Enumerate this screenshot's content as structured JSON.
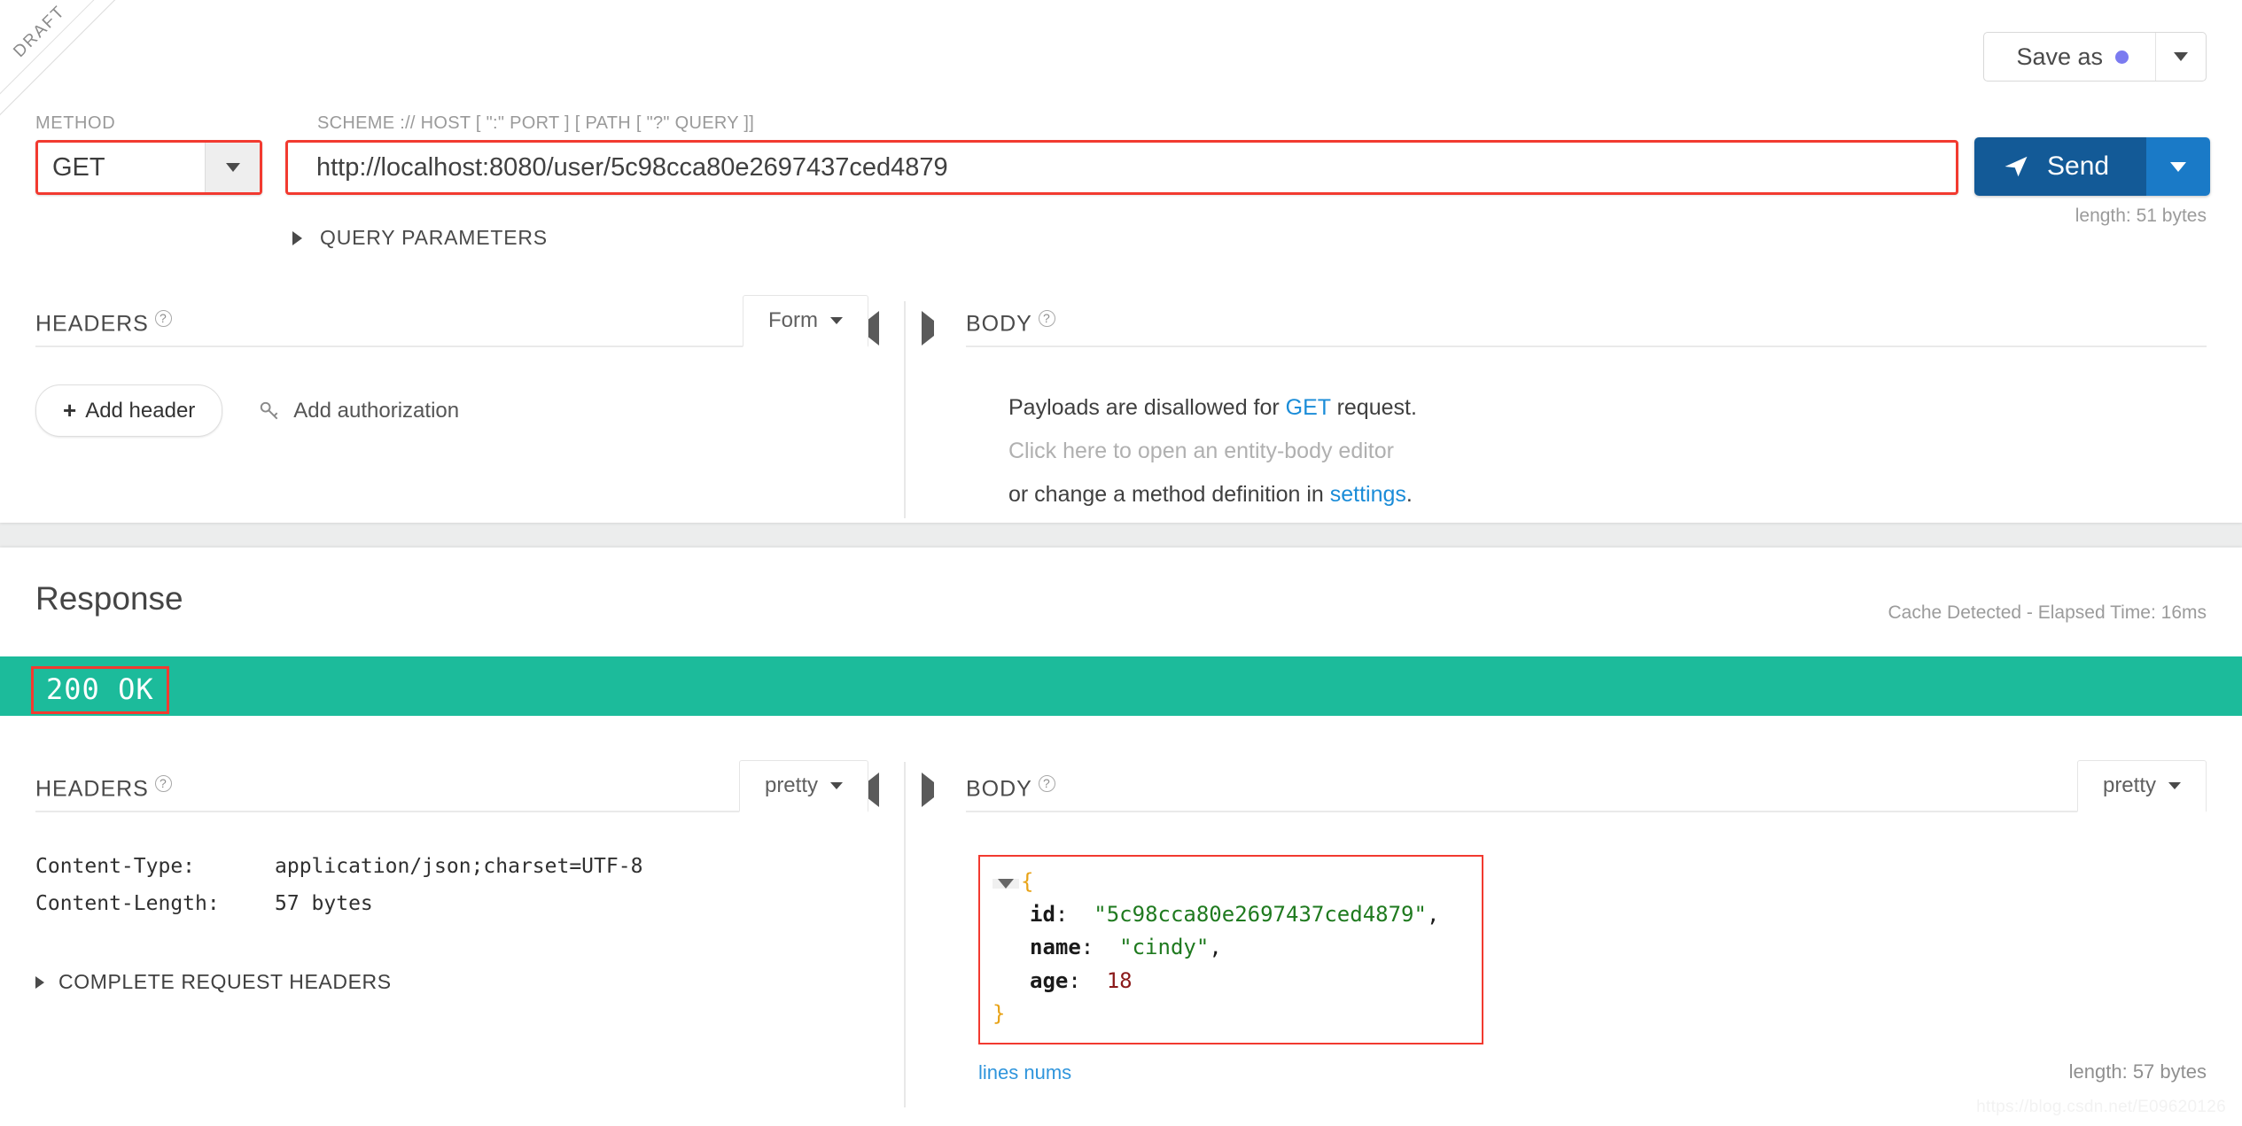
{
  "ribbon": {
    "label": "DRAFT"
  },
  "toolbar": {
    "save_as_label": "Save as",
    "save_as_dot_color": "#7b7bf0",
    "caret_icon": "chevron-down-icon"
  },
  "request": {
    "method_label": "METHOD",
    "method_value": "GET",
    "url_label": "SCHEME :// HOST [ \":\" PORT ] [ PATH [ \"?\" QUERY ]]",
    "url_value": "http://localhost:8080/user/5c98cca80e2697437ced4879",
    "url_placeholder": "http://",
    "send_label": "Send",
    "send_icon": "paper-plane-icon",
    "length_label": "length: 51 bytes",
    "query_params_label": "QUERY PARAMETERS",
    "headers": {
      "title": "HEADERS",
      "help_icon": "question-mark-icon",
      "mode_value": "Form",
      "add_header_label": "Add header",
      "add_authorization_label": "Add authorization",
      "auth_icon": "key-icon"
    },
    "body": {
      "title": "BODY",
      "help_icon": "question-mark-icon",
      "line1_prefix": "Payloads are disallowed for ",
      "line1_link": "GET",
      "line1_suffix": " request.",
      "line2": "Click here to open an entity-body editor",
      "line3_prefix": "or change a method definition in ",
      "line3_link": "settings",
      "line3_suffix": "."
    }
  },
  "response": {
    "title": "Response",
    "cache_info": "Cache Detected - Elapsed Time: 16ms",
    "status_code": "200 OK",
    "status_color": "#1cbb9b",
    "headers": {
      "title": "HEADERS",
      "help_icon": "question-mark-icon",
      "mode_value": "pretty",
      "rows": [
        {
          "key": "Content-Type:",
          "value": "application/json;charset=UTF-8"
        },
        {
          "key": "Content-Length:",
          "value": "57 bytes"
        }
      ],
      "complete_request_headers_label": "COMPLETE REQUEST HEADERS"
    },
    "body": {
      "title": "BODY",
      "help_icon": "question-mark-icon",
      "mode_value": "pretty",
      "json": {
        "open_brace": "{",
        "close_brace": "}",
        "fields": [
          {
            "key": "id",
            "sep": ":",
            "value": "\"5c98cca80e2697437ced4879\"",
            "type": "string",
            "comma": ","
          },
          {
            "key": "name",
            "sep": ":",
            "value": "\"cindy\"",
            "type": "string",
            "comma": ","
          },
          {
            "key": "age",
            "sep": ":",
            "value": "18",
            "type": "number",
            "comma": ""
          }
        ]
      },
      "lines_nums_label": "lines nums",
      "length_label": "length: 57 bytes"
    }
  },
  "watermark": "https://blog.csdn.net/E09620126"
}
